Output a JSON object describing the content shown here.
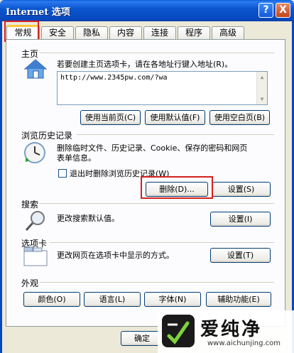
{
  "window": {
    "title": "Internet 选项",
    "help_label": "?",
    "close_label": "X"
  },
  "tabs": [
    {
      "label": "常规",
      "active": true
    },
    {
      "label": "安全"
    },
    {
      "label": "隐私"
    },
    {
      "label": "内容"
    },
    {
      "label": "连接"
    },
    {
      "label": "程序"
    },
    {
      "label": "高级"
    }
  ],
  "homepage": {
    "title": "主页",
    "description": "若要创建主页选项卡，请在各地址行键入地址(R)。",
    "address": "http://www.2345pw.com/?wa",
    "use_current": "使用当前页(C)",
    "use_default": "使用默认值(F)",
    "use_blank": "使用空白页(B)"
  },
  "history": {
    "title": "浏览历史记录",
    "description_line1": "删除临时文件、历史记录、Cookie、保存的密码和网页",
    "description_line2": "表单信息。",
    "checkbox_label": "退出时删除浏览历史记录(W)",
    "delete_button": "删除(D)...",
    "settings_button": "设置(S)"
  },
  "search": {
    "title": "搜索",
    "description": "更改搜索默认值。",
    "settings_button": "设置(I)"
  },
  "tabs_section": {
    "title": "选项卡",
    "description": "更改网页在选项卡中显示的方式。",
    "settings_button": "设置(T)"
  },
  "appearance": {
    "title": "外观",
    "colors": "颜色(O)",
    "languages": "语言(L)",
    "fonts": "字体(N)",
    "accessibility": "辅助功能(E)"
  },
  "footer": {
    "ok": "确定"
  },
  "watermark": {
    "brand": "爱纯净",
    "url": "www.aichunjing.com"
  }
}
